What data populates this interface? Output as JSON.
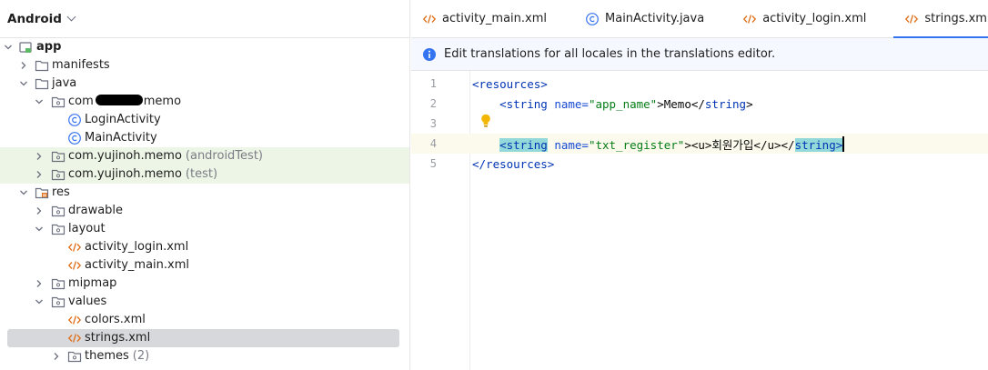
{
  "project_panel": {
    "title": "Android",
    "tree": [
      {
        "label": "app",
        "icon": "module-icon",
        "expanded": true
      },
      {
        "label": "manifests",
        "icon": "folder-icon",
        "expanded": false
      },
      {
        "label": "java",
        "icon": "folder-icon",
        "expanded": true
      },
      {
        "label_prefix": "com",
        "label_suffix": "memo",
        "icon": "package-icon",
        "expanded": true,
        "redacted": true
      },
      {
        "label": "LoginActivity",
        "icon": "class-icon"
      },
      {
        "label": "MainActivity",
        "icon": "class-icon"
      },
      {
        "label": "com.yujinoh.memo",
        "suffix": "(androidTest)",
        "icon": "package-icon",
        "expanded": false
      },
      {
        "label": "com.yujinoh.memo",
        "suffix": "(test)",
        "icon": "package-icon",
        "expanded": false
      },
      {
        "label": "res",
        "icon": "res-folder-icon",
        "expanded": true
      },
      {
        "label": "drawable",
        "icon": "package-icon",
        "expanded": false
      },
      {
        "label": "layout",
        "icon": "package-icon",
        "expanded": true
      },
      {
        "label": "activity_login.xml",
        "icon": "xml-icon"
      },
      {
        "label": "activity_main.xml",
        "icon": "xml-icon"
      },
      {
        "label": "mipmap",
        "icon": "package-icon",
        "expanded": false
      },
      {
        "label": "values",
        "icon": "package-icon",
        "expanded": true
      },
      {
        "label": "colors.xml",
        "icon": "xml-icon"
      },
      {
        "label": "strings.xml",
        "icon": "xml-icon",
        "selected": true
      },
      {
        "label": "themes",
        "suffix": "(2)",
        "icon": "package-icon",
        "expanded": false
      }
    ]
  },
  "editor": {
    "tabs": [
      {
        "label": "activity_main.xml",
        "icon": "xml-icon",
        "active": false
      },
      {
        "label": "MainActivity.java",
        "icon": "class-icon",
        "active": false
      },
      {
        "label": "activity_login.xml",
        "icon": "xml-icon",
        "active": false
      },
      {
        "label": "strings.xml",
        "icon": "xml-icon",
        "active": true
      }
    ],
    "banner": "Edit translations for all locales in the translations editor.",
    "lines": [
      {
        "n": "1",
        "open": "<resources>"
      },
      {
        "n": "2",
        "tag_open": "<string",
        "attr": " name=",
        "val": "\"app_name\"",
        "after": ">Memo</",
        "tag_close": "string",
        "end": ">"
      },
      {
        "n": "3"
      },
      {
        "n": "4",
        "tag_open": "<string",
        "attr": " name=",
        "val": "\"txt_register\"",
        "after": "><u>회원가입</u></",
        "tag_close": "string",
        "end": ">"
      },
      {
        "n": "5",
        "open": "</resources>"
      }
    ]
  },
  "colors": {
    "accent": "#3574f0",
    "highlight_green": "#edf5e6",
    "selection": "#d7d8dc",
    "xml_icon": "#e0701b",
    "class_icon": "#3574f0"
  }
}
